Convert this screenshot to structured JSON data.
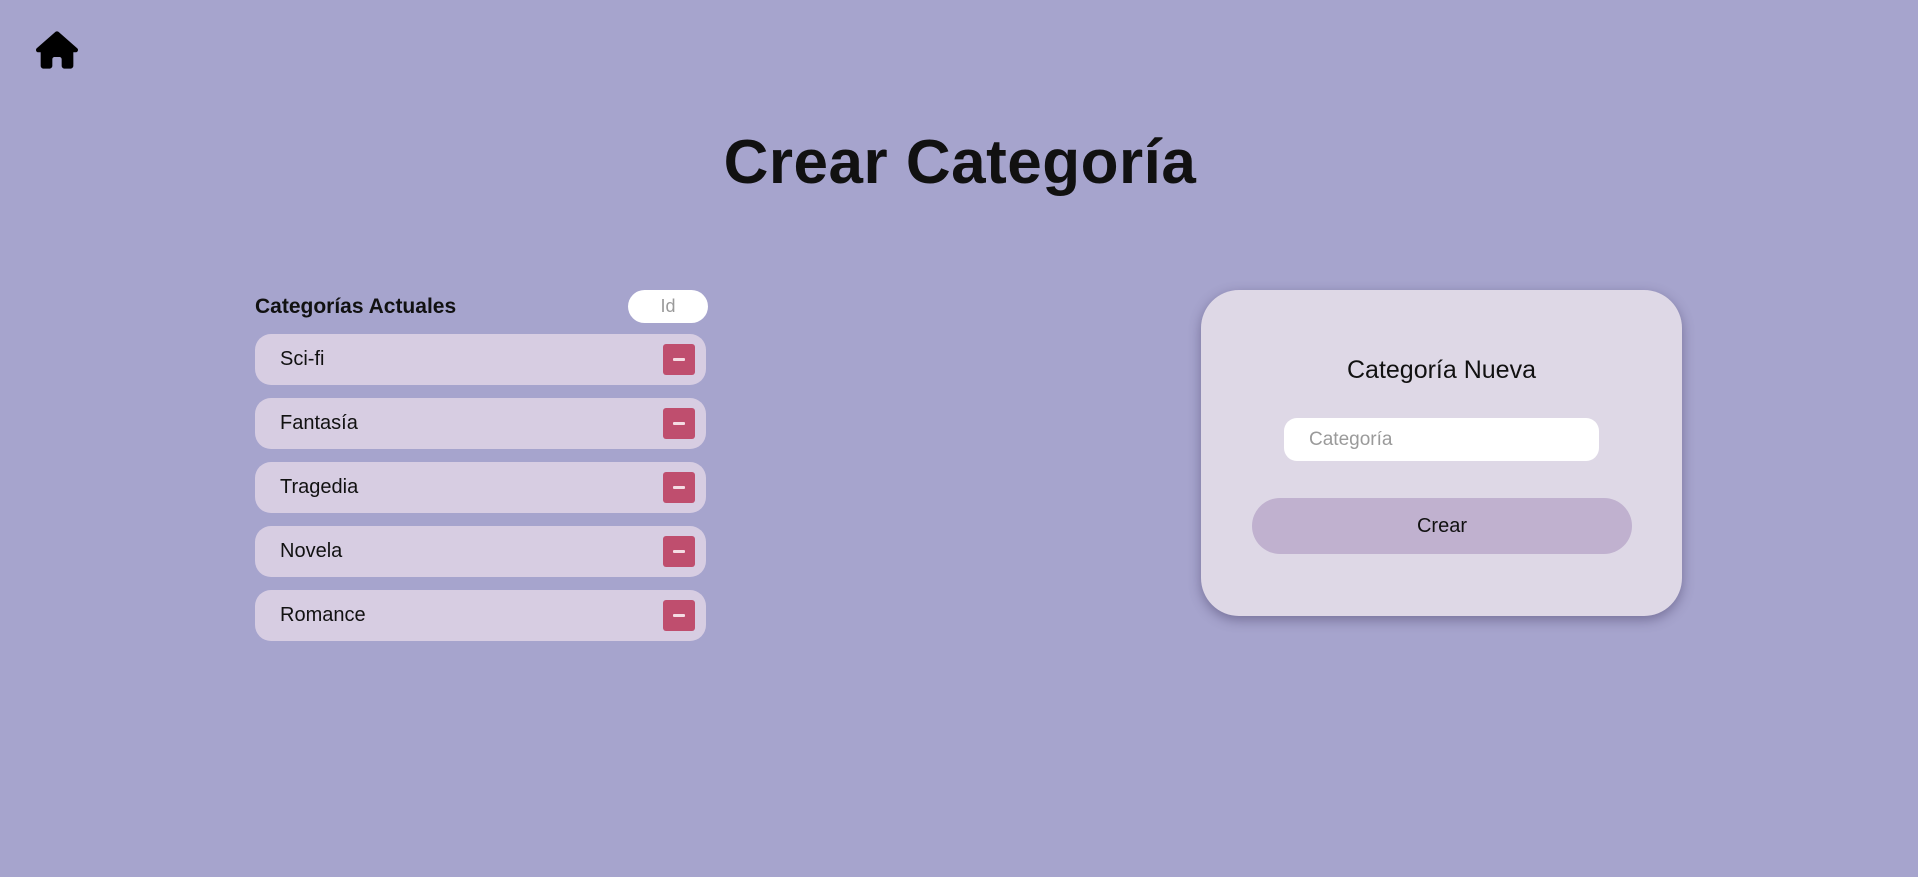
{
  "nav": {
    "home_icon": "home-icon"
  },
  "page": {
    "title": "Crear Categoría"
  },
  "categories_panel": {
    "title": "Categorías Actuales",
    "id_placeholder": "Id",
    "items": [
      {
        "label": "Sci-fi",
        "remove_icon": "minus-icon"
      },
      {
        "label": "Fantasía",
        "remove_icon": "minus-icon"
      },
      {
        "label": "Tragedia",
        "remove_icon": "minus-icon"
      },
      {
        "label": "Novela",
        "remove_icon": "minus-icon"
      },
      {
        "label": "Romance",
        "remove_icon": "minus-icon"
      }
    ]
  },
  "new_category_form": {
    "title": "Categoría Nueva",
    "input_placeholder": "Categoría",
    "submit_label": "Crear"
  },
  "colors": {
    "background": "#a6a4cd",
    "list_item_bg": "#d7cde2",
    "delete_button": "#bf4e6e",
    "card_bg": "#ded8e6",
    "create_button": "#c0b1cf"
  }
}
